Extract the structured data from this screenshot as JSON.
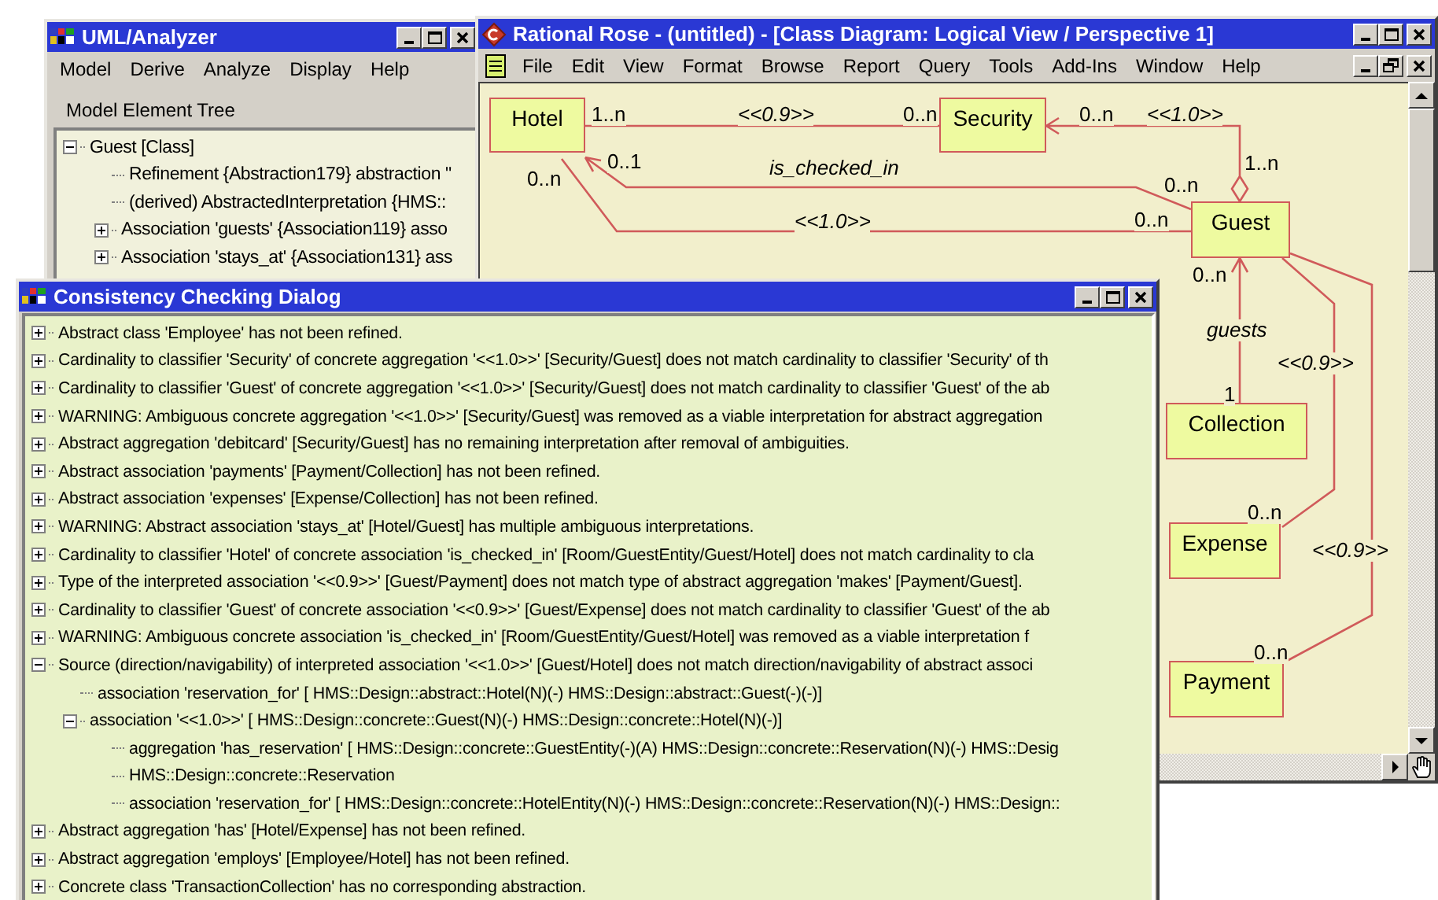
{
  "analyzer_window": {
    "title": "UML/Analyzer",
    "menu": [
      "Model",
      "Derive",
      "Analyze",
      "Display",
      "Help"
    ],
    "tree_label": "Model Element Tree",
    "tree": [
      {
        "text": "Guest [Class]",
        "expanded": true,
        "children": [
          {
            "text": "Refinement  {Abstraction179} abstraction \""
          },
          {
            "text": "(derived) AbstractedInterpretation  {HMS::"
          },
          {
            "text": "Association 'guests' {Association119} asso",
            "expanded": false
          },
          {
            "text": "Association 'stays_at' {Association131} ass",
            "expanded": false
          }
        ]
      }
    ]
  },
  "rose_window": {
    "title": "Rational Rose - (untitled) - [Class Diagram: Logical View / Perspective 1]",
    "menu": [
      "File",
      "Edit",
      "View",
      "Format",
      "Browse",
      "Report",
      "Query",
      "Tools",
      "Add-Ins",
      "Window",
      "Help"
    ],
    "diagram": {
      "classes": [
        {
          "name": "Hotel"
        },
        {
          "name": "Security"
        },
        {
          "name": "Guest"
        },
        {
          "name": "Collection"
        },
        {
          "name": "Expense"
        },
        {
          "name": "Payment"
        }
      ],
      "labels": [
        {
          "text": "1..n",
          "kind": "multiplicity"
        },
        {
          "text": "<<0.9>>",
          "kind": "stereotype"
        },
        {
          "text": "0..n",
          "kind": "multiplicity"
        },
        {
          "text": "0..n",
          "kind": "multiplicity"
        },
        {
          "text": "<<1.0>>",
          "kind": "stereotype"
        },
        {
          "text": "0..1",
          "kind": "multiplicity"
        },
        {
          "text": "is_checked_in",
          "kind": "role"
        },
        {
          "text": "1..n",
          "kind": "multiplicity"
        },
        {
          "text": "0..n",
          "kind": "multiplicity"
        },
        {
          "text": "0..n",
          "kind": "multiplicity"
        },
        {
          "text": "<<1.0>>",
          "kind": "stereotype"
        },
        {
          "text": "0..n",
          "kind": "multiplicity"
        },
        {
          "text": "0..n",
          "kind": "multiplicity"
        },
        {
          "text": "guests",
          "kind": "role"
        },
        {
          "text": "<<0.9>>",
          "kind": "stereotype"
        },
        {
          "text": "1",
          "kind": "multiplicity"
        },
        {
          "text": "0..n",
          "kind": "multiplicity"
        },
        {
          "text": "<<0.9>>",
          "kind": "stereotype"
        },
        {
          "text": "0..n",
          "kind": "multiplicity"
        }
      ]
    }
  },
  "dialog": {
    "title": "Consistency Checking Dialog",
    "messages": [
      {
        "text": "Abstract class 'Employee' has not been refined.",
        "expanded": false
      },
      {
        "text": "Cardinality to classifier 'Security' of concrete aggregation '<<1.0>>' [Security/Guest] does not match cardinality to classifier 'Security' of th",
        "expanded": false
      },
      {
        "text": "Cardinality to classifier 'Guest' of concrete aggregation '<<1.0>>' [Security/Guest] does not match cardinality to classifier 'Guest' of the ab",
        "expanded": false
      },
      {
        "text": "WARNING: Ambiguous concrete aggregation '<<1.0>>' [Security/Guest] was removed as a viable interpretation for abstract aggregation",
        "expanded": false
      },
      {
        "text": "Abstract aggregation 'debitcard' [Security/Guest] has no remaining interpretation after removal of ambiguities.",
        "expanded": false
      },
      {
        "text": "Abstract association 'payments' [Payment/Collection] has not been refined.",
        "expanded": false
      },
      {
        "text": "Abstract association 'expenses' [Expense/Collection] has not been refined.",
        "expanded": false
      },
      {
        "text": "WARNING: Abstract association 'stays_at' [Hotel/Guest] has multiple ambiguous interpretations.",
        "expanded": false
      },
      {
        "text": "Cardinality to classifier 'Hotel' of concrete association 'is_checked_in' [Room/GuestEntity/Guest/Hotel] does not match cardinality to cla",
        "expanded": false
      },
      {
        "text": "Type of the interpreted association '<<0.9>>' [Guest/Payment] does not match type of abstract aggregation 'makes' [Payment/Guest].",
        "expanded": false
      },
      {
        "text": "Cardinality to classifier 'Guest' of concrete association '<<0.9>>' [Guest/Expense] does not match cardinality to classifier 'Guest' of the ab",
        "expanded": false
      },
      {
        "text": "WARNING: Ambiguous concrete association 'is_checked_in' [Room/GuestEntity/Guest/Hotel] was removed as a viable interpretation f",
        "expanded": false
      },
      {
        "text": "Source (direction/navigability) of interpreted association '<<1.0>>' [Guest/Hotel] does not match direction/navigability of abstract associ",
        "expanded": true,
        "children": [
          {
            "text": "association 'reservation_for' [ HMS::Design::abstract::Hotel(N)(-) HMS::Design::abstract::Guest(-)(-)]"
          },
          {
            "text": "association '<<1.0>>' [ HMS::Design::concrete::Guest(N)(-) HMS::Design::concrete::Hotel(N)(-)]",
            "expanded": true,
            "children": [
              {
                "text": "aggregation 'has_reservation' [ HMS::Design::concrete::GuestEntity(-)(A) HMS::Design::concrete::Reservation(N)(-) HMS::Desig"
              },
              {
                "text": "HMS::Design::concrete::Reservation"
              },
              {
                "text": "association 'reservation_for' [ HMS::Design::concrete::HotelEntity(N)(-) HMS::Design::concrete::Reservation(N)(-) HMS::Design::"
              }
            ]
          }
        ]
      },
      {
        "text": "Abstract aggregation 'has' [Hotel/Expense] has not been refined.",
        "expanded": false
      },
      {
        "text": "Abstract aggregation 'employs' [Employee/Hotel] has not been refined.",
        "expanded": false
      },
      {
        "text": "Concrete class 'TransactionCollection' has no corresponding abstraction.",
        "expanded": false
      }
    ]
  }
}
